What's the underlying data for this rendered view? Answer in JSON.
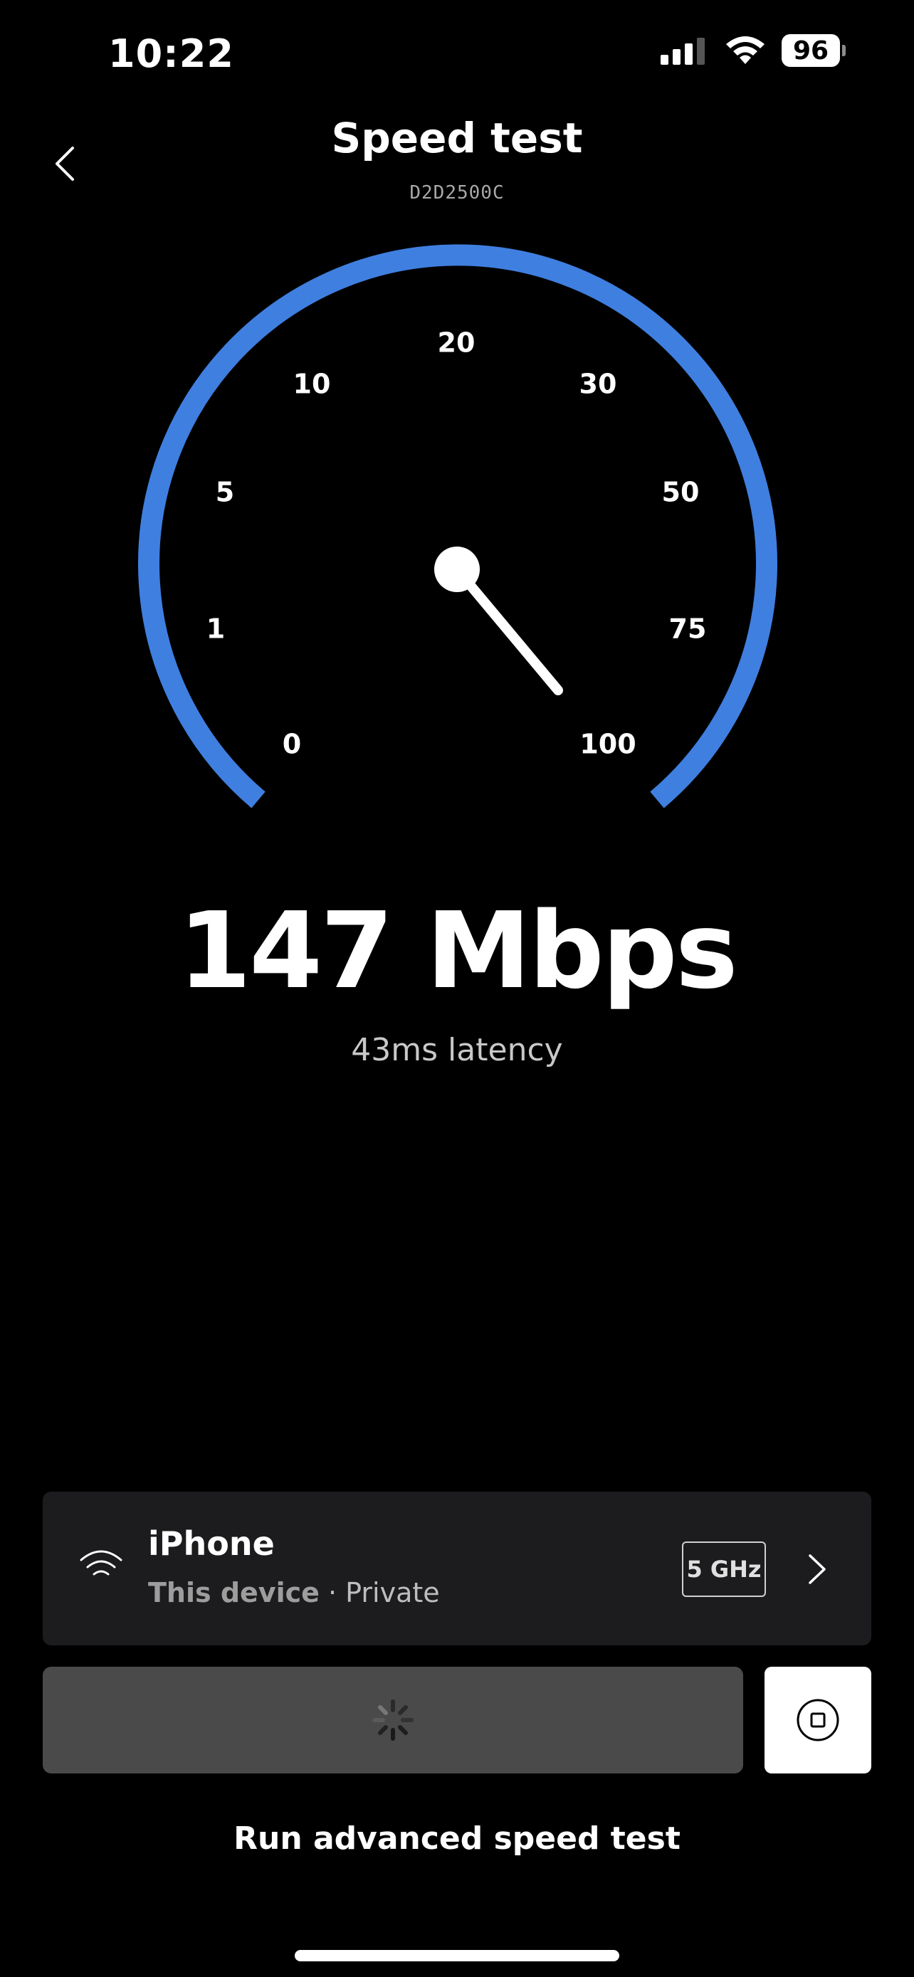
{
  "status_bar": {
    "time": "10:22",
    "battery": "96"
  },
  "header": {
    "title": "Speed test",
    "subtitle": "D2D2500C"
  },
  "gauge": {
    "ticks": [
      "0",
      "1",
      "5",
      "10",
      "20",
      "30",
      "50",
      "75",
      "100"
    ],
    "arc_color": "#3F7FE0"
  },
  "result": {
    "speed": "147 Mbps",
    "latency": "43ms latency"
  },
  "device": {
    "name": "iPhone",
    "type": "This device",
    "network": "· Private",
    "band": "5 GHz"
  },
  "actions": {
    "advanced_label": "Run advanced speed test"
  },
  "icons": {
    "back": "chevron-left-icon",
    "wifi": "wifi-icon",
    "chevron": "chevron-right-icon",
    "spinner": "loading-spinner-icon",
    "stop": "stop-icon"
  }
}
